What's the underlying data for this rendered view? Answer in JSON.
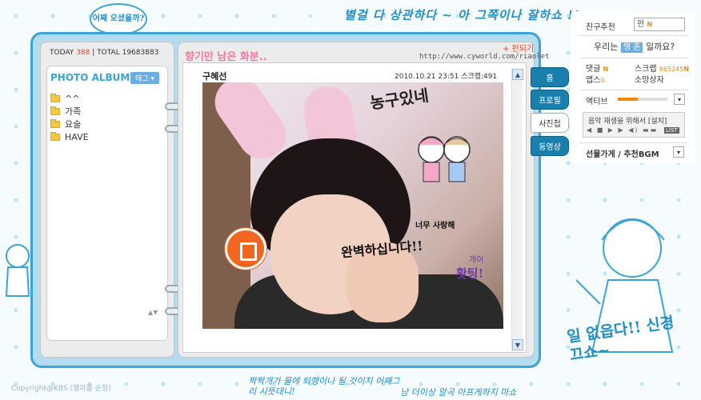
{
  "decor": {
    "top_scribble": "별걸 다 상관하다 ~ 아 그쪽이나 잘하쇼 !!",
    "bubble_topleft": "어째 오셨을까?",
    "bottom_scribble1": "짝짝개가 물에 퇴행이나 될 것이지 어째그리 시뜻대니!",
    "bottom_scribble2": "남 더이상 알곡 아프게하지 마쇼",
    "right_bubble": "일 없읍다!! 신경끄쇼~",
    "copyright": "Copyright@KBS (열아홉 순정)"
  },
  "counter": {
    "today_label": "TODAY",
    "today_value": "388",
    "separator": "|",
    "total_label": "TOTAL",
    "total_value": "19683883"
  },
  "album": {
    "title": "PHOTO ALBUM",
    "tag_button": "태그 ▾",
    "folders": [
      "^^",
      "가족",
      "요술",
      "HAVE"
    ],
    "scroll_arrows": "▲▼"
  },
  "page": {
    "title": "향기만 남은 화분..",
    "flip_link": "+ 펀되기",
    "url": "http://www.cyworld.com/riaolet"
  },
  "post": {
    "author": "구혜선",
    "date_scrap": "2010.10.21 23:51   스크랩:491",
    "photo_text_top": "농구있네",
    "photo_text_love": "너무 사랑해",
    "photo_text_perfect": "완벽하십니다!!",
    "photo_text_fighting_small": "개이",
    "photo_text_fighting": "홧팅!"
  },
  "tabs": [
    "홈",
    "프로필",
    "사진첩",
    "동영상"
  ],
  "sidebar": {
    "friend_rec_label": "친구추천",
    "friend_select": "펀",
    "new_marker": "N",
    "question_prefix": "우리는",
    "question_badge": "맹 촌",
    "question_suffix": "일까요?",
    "stat_reply_label": "댓글",
    "stat_apps_label": "앱스",
    "stat_apps_value": "0",
    "stat_scrap_label": "스크랩",
    "stat_scrap_value": "865245",
    "stat_wish_label": "소망상자",
    "activity_label": "액티브",
    "activity_level": 0.4,
    "player_msg": "음악 재생을 위해서 [설치]",
    "player_controls": "◀ ■ ▶ ▶ ◀) ▬▬",
    "player_list": "LIST",
    "bgm_label": "선물가게 / 추천BGM",
    "dropdown_glyph": "▾"
  },
  "colors": {
    "accent_blue": "#3aa3d8",
    "tab_blue": "#1b7fae",
    "orange": "#f3661f",
    "pink_title": "#f07aa5"
  }
}
